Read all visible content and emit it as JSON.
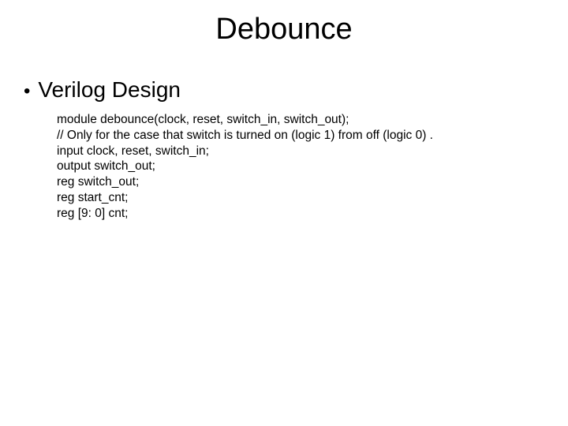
{
  "title": "Debounce",
  "section": "Verilog Design",
  "code": {
    "l1": "module debounce(clock, reset, switch_in, switch_out);",
    "l2": "// Only for the case that switch is turned on (logic 1) from off (logic 0) .",
    "l3": "input clock, reset, switch_in;",
    "l4": "output switch_out;",
    "l5": "reg switch_out;",
    "l6": "",
    "l7": "reg start_cnt;",
    "l8": "",
    "l9": "reg [9: 0] cnt;"
  }
}
